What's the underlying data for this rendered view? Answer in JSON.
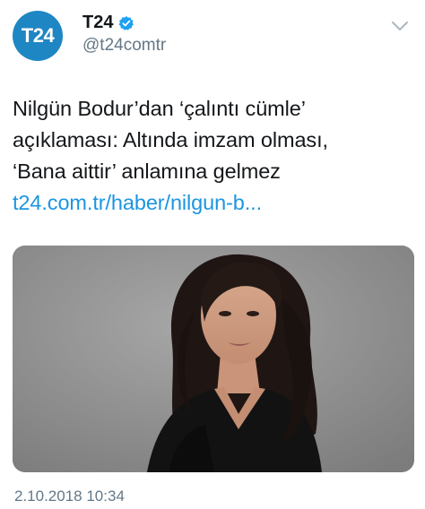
{
  "account": {
    "avatar_text": "T24",
    "display_name": "T24",
    "handle": "@t24comtr",
    "verified": true,
    "brand_color": "#1f86c4"
  },
  "tweet": {
    "text_lines": [
      "Nilgün Bodur’dan ‘çalıntı cümle’",
      "açıklaması: Altında imzam olması,",
      "‘Bana aittir’ anlamına gelmez"
    ],
    "link_text": "t24.com.tr/haber/nilgun-b...",
    "link_color": "#1b95e0",
    "timestamp": "2.10.2018 10:34"
  },
  "media": {
    "description_icon": "photo-of-woman-in-black-dress"
  },
  "icons": {
    "verified": "verified-badge-icon",
    "menu": "chevron-down-icon"
  }
}
